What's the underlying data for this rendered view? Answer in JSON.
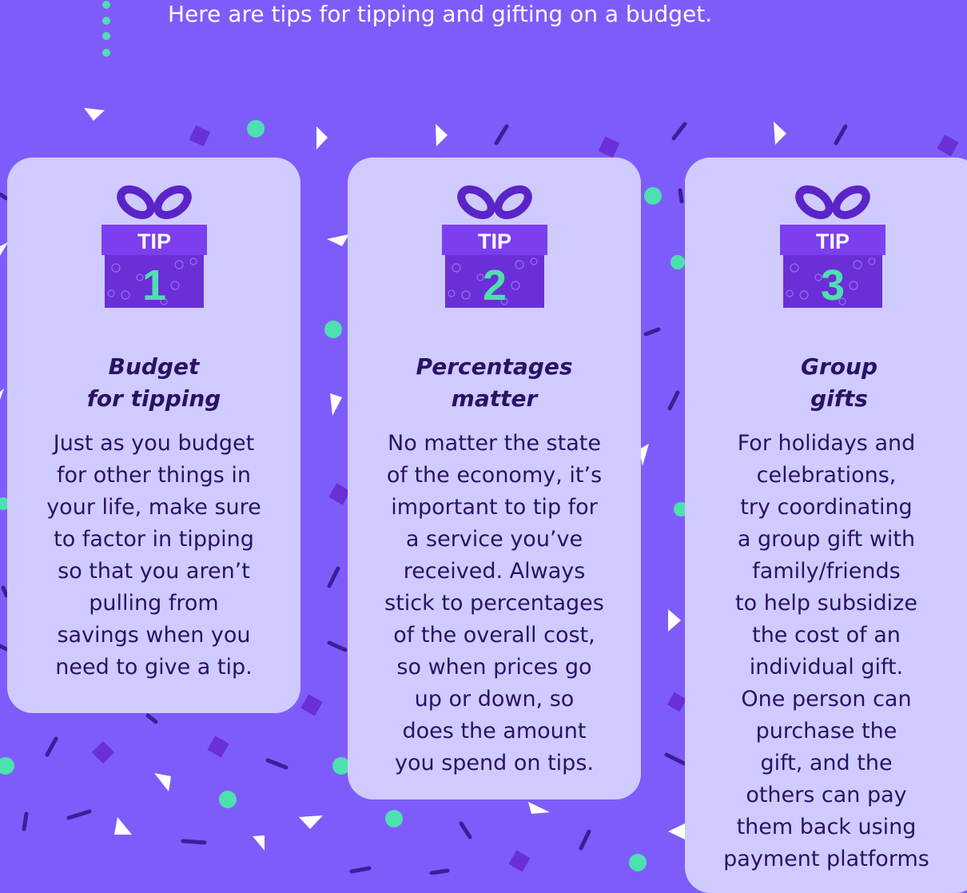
{
  "intro_text": "Here are tips for tipping and gifting on a budget.",
  "colors": {
    "background": "#7e5cfb",
    "card": "#cfcbff",
    "text": "#2a1266",
    "gift_box": "#6a2fd6",
    "gift_lid": "#7c3ff0",
    "teal": "#4de0b0",
    "confetti_dark": "#3b1f99",
    "confetti_mid": "#6a2fd6",
    "confetti_white": "#ffffff"
  },
  "tips": [
    {
      "badge_label": "TIP",
      "number": "1",
      "title": "Budget\nfor tipping",
      "body": "Just as you budget\nfor other things in\nyour life, make sure\nto factor in tipping\nso that you aren’t\npulling from\nsavings when you\nneed to give a tip."
    },
    {
      "badge_label": "TIP",
      "number": "2",
      "title": "Percentages\nmatter",
      "body": "No matter the state\nof the economy, it’s\nimportant to tip for\na service you’ve\nreceived. Always\nstick to percentages\nof the overall cost,\nso when prices go\nup or down, so\ndoes the amount\nyou spend on tips."
    },
    {
      "badge_label": "TIP",
      "number": "3",
      "title": "Group\ngifts",
      "body": "For holidays and\ncelebrations,\ntry coordinating\na group gift with\nfamily/friends\nto help subsidize\nthe cost of an\nindividual gift.\nOne person can\npurchase the\ngift, and the\nothers can pay\nthem back using\npayment platforms"
    }
  ]
}
